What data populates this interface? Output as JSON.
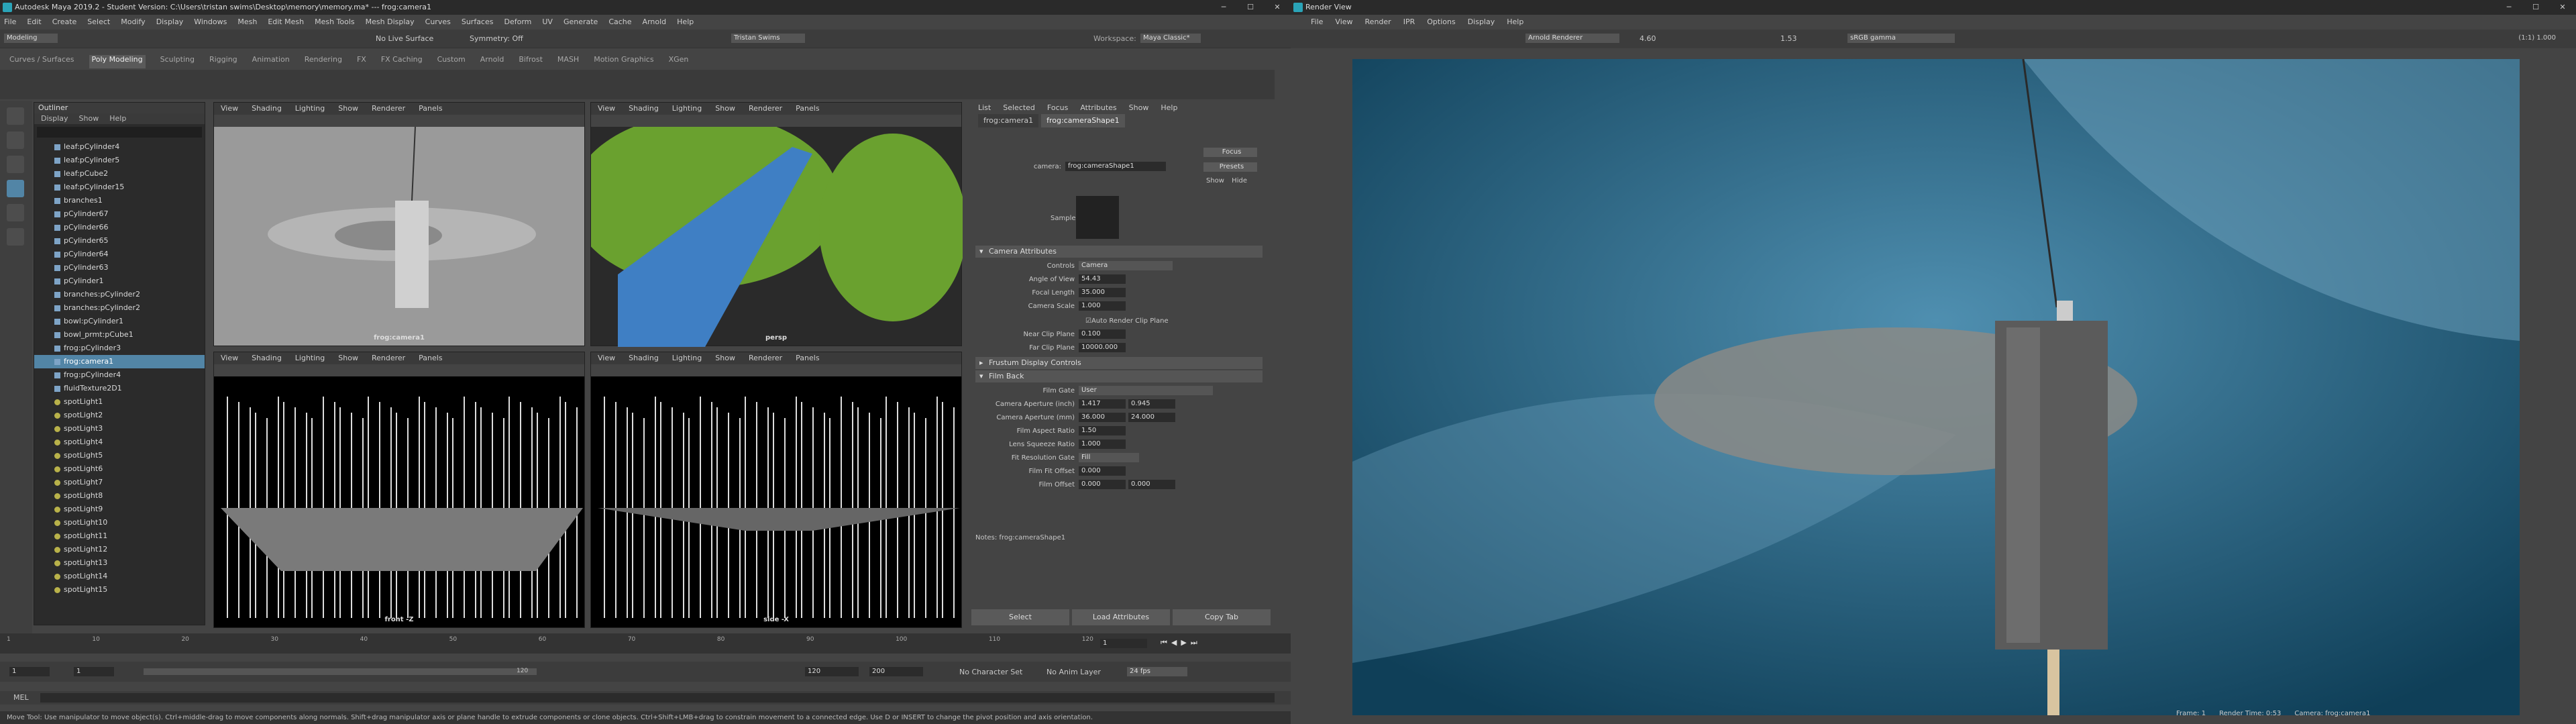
{
  "maya": {
    "title": "Autodesk Maya 2019.2 - Student Version: C:\\Users\\tristan swims\\Desktop\\memory\\memory.ma* --- frog:camera1",
    "menus": [
      "File",
      "Edit",
      "Create",
      "Select",
      "Modify",
      "Display",
      "Windows",
      "Mesh",
      "Edit Mesh",
      "Mesh Tools",
      "Mesh Display",
      "Curves",
      "Surfaces",
      "Deform",
      "UV",
      "Generate",
      "Cache",
      "Arnold",
      "Help"
    ],
    "mode": "Modeling",
    "surface": "No Live Surface",
    "symmetry": "Symmetry: Off",
    "user": "Tristan Swims",
    "workspace_label": "Workspace:",
    "workspace": "Maya Classic*",
    "shelf_tabs": [
      "Curves / Surfaces",
      "Poly Modeling",
      "Sculpting",
      "Rigging",
      "Animation",
      "Rendering",
      "FX",
      "FX Caching",
      "Custom",
      "Arnold",
      "Bifrost",
      "MASH",
      "Motion Graphics",
      "XGen"
    ],
    "outliner": {
      "title": "Outliner",
      "menu": [
        "Display",
        "Show",
        "Help"
      ],
      "items": [
        "leaf:pCylinder4",
        "leaf:pCylinder5",
        "leaf:pCube2",
        "leaf:pCylinder15",
        "branches1",
        "pCylinder67",
        "pCylinder66",
        "pCylinder65",
        "pCylinder64",
        "pCylinder63",
        "pCylinder1",
        "branches:pCylinder2",
        "branches:pCylinder2",
        "bowl:pCylinder1",
        "bowl_prmt:pCube1",
        "frog:pCylinder3",
        "frog:camera1",
        "frog:pCylinder4",
        "fluidTexture2D1",
        "spotLight1",
        "spotLight2",
        "spotLight3",
        "spotLight4",
        "spotLight5",
        "spotLight6",
        "spotLight7",
        "spotLight8",
        "spotLight9",
        "spotLight10",
        "spotLight11",
        "spotLight12",
        "spotLight13",
        "spotLight14",
        "spotLight15"
      ]
    },
    "viewport_menu": [
      "View",
      "Shading",
      "Lighting",
      "Show",
      "Renderer",
      "Panels"
    ],
    "viewports": [
      {
        "label": "frog:camera1"
      },
      {
        "label": "persp"
      },
      {
        "label": "front -Z"
      },
      {
        "label": "side -X"
      }
    ],
    "ae": {
      "menu": [
        "List",
        "Selected",
        "Focus",
        "Attributes",
        "Show",
        "Help"
      ],
      "tabs": [
        "frog:camera1",
        "frog:cameraShape1"
      ],
      "camera_label": "camera:",
      "camera_value": "frog:cameraShape1",
      "focus": "Focus",
      "presets": "Presets",
      "show": "Show",
      "hide": "Hide",
      "sample": "Sample",
      "sec_camera": "Camera Attributes",
      "sec_frustum": "Frustum Display Controls",
      "sec_filmback": "Film Back",
      "controls_k": "Controls",
      "controls_v": "Camera",
      "aov_k": "Angle of View",
      "aov_v": "54.43",
      "focal_k": "Focal Length",
      "focal_v": "35.000",
      "scale_k": "Camera Scale",
      "scale_v": "1.000",
      "auto_clip": "Auto Render Clip Plane",
      "near_k": "Near Clip Plane",
      "near_v": "0.100",
      "far_k": "Far Clip Plane",
      "far_v": "10000.000",
      "gate_k": "Film Gate",
      "gate_v": "User",
      "apin_k": "Camera Aperture (inch)",
      "apin_v1": "1.417",
      "apin_v2": "0.945",
      "apmm_k": "Camera Aperture (mm)",
      "apmm_v1": "36.000",
      "apmm_v2": "24.000",
      "far_ratio_k": "Film Aspect Ratio",
      "far_ratio_v": "1.50",
      "lens_k": "Lens Squeeze Ratio",
      "lens_v": "1.000",
      "fitres_k": "Fit Resolution Gate",
      "fitres_v": "Fill",
      "fitoff_k": "Film Fit Offset",
      "fitoff_v": "0.000",
      "offset_k": "Film Offset",
      "offset_v1": "0.000",
      "offset_v2": "0.000",
      "notes": "Notes:  frog:cameraShape1",
      "select": "Select",
      "load": "Load Attributes",
      "copy": "Copy Tab"
    },
    "time": {
      "start": "1",
      "range_start": "1",
      "range_end": "120",
      "end": "120",
      "total": "200",
      "cur": "1",
      "fps": "24 fps",
      "charset": "No Character Set",
      "animlayer": "No Anim Layer",
      "ticks": [
        "1",
        "10",
        "20",
        "30",
        "40",
        "50",
        "60",
        "70",
        "80",
        "90",
        "100",
        "110",
        "120"
      ]
    },
    "mel": "MEL",
    "help": "Move Tool: Use manipulator to move object(s). Ctrl+middle-drag to move components along normals. Shift+drag manipulator axis or plane handle to extrude components or clone objects. Ctrl+Shift+LMB+drag to constrain movement to a connected edge. Use D or INSERT to change the pivot position and axis orientation."
  },
  "renderview": {
    "title": "Render View",
    "menus": [
      "File",
      "View",
      "Render",
      "IPR",
      "Options",
      "Display",
      "Help"
    ],
    "renderer": "Arnold Renderer",
    "exposure": "4.60",
    "gamma": "1.53",
    "colorspace": "sRGB gamma",
    "zoom": "(1:1) 1.000",
    "footer_frame": "Frame: 1",
    "footer_time": "Render Time: 0:53",
    "footer_camera": "Camera: frog:camera1"
  },
  "colors": {
    "accent": "#5285a6",
    "water": "#1b5a7a"
  }
}
